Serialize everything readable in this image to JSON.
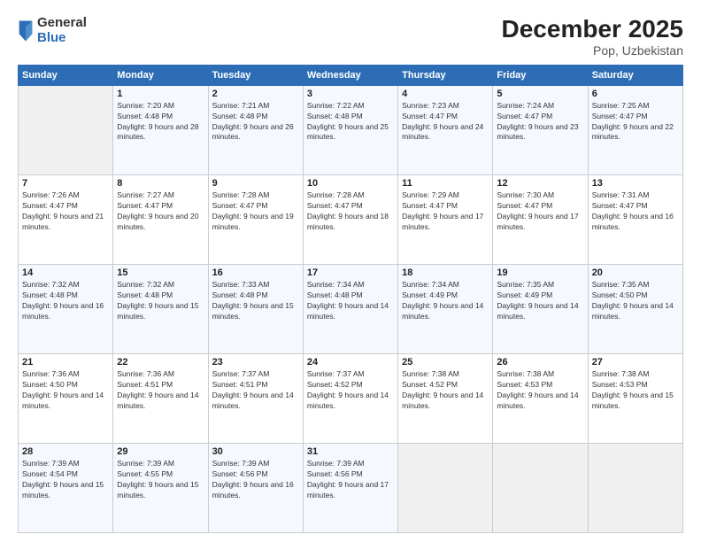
{
  "logo": {
    "general": "General",
    "blue": "Blue"
  },
  "title": "December 2025",
  "subtitle": "Pop, Uzbekistan",
  "days_header": [
    "Sunday",
    "Monday",
    "Tuesday",
    "Wednesday",
    "Thursday",
    "Friday",
    "Saturday"
  ],
  "weeks": [
    [
      {
        "day": "",
        "sunrise": "",
        "sunset": "",
        "daylight": ""
      },
      {
        "day": "1",
        "sunrise": "Sunrise: 7:20 AM",
        "sunset": "Sunset: 4:48 PM",
        "daylight": "Daylight: 9 hours and 28 minutes."
      },
      {
        "day": "2",
        "sunrise": "Sunrise: 7:21 AM",
        "sunset": "Sunset: 4:48 PM",
        "daylight": "Daylight: 9 hours and 26 minutes."
      },
      {
        "day": "3",
        "sunrise": "Sunrise: 7:22 AM",
        "sunset": "Sunset: 4:48 PM",
        "daylight": "Daylight: 9 hours and 25 minutes."
      },
      {
        "day": "4",
        "sunrise": "Sunrise: 7:23 AM",
        "sunset": "Sunset: 4:47 PM",
        "daylight": "Daylight: 9 hours and 24 minutes."
      },
      {
        "day": "5",
        "sunrise": "Sunrise: 7:24 AM",
        "sunset": "Sunset: 4:47 PM",
        "daylight": "Daylight: 9 hours and 23 minutes."
      },
      {
        "day": "6",
        "sunrise": "Sunrise: 7:25 AM",
        "sunset": "Sunset: 4:47 PM",
        "daylight": "Daylight: 9 hours and 22 minutes."
      }
    ],
    [
      {
        "day": "7",
        "sunrise": "Sunrise: 7:26 AM",
        "sunset": "Sunset: 4:47 PM",
        "daylight": "Daylight: 9 hours and 21 minutes."
      },
      {
        "day": "8",
        "sunrise": "Sunrise: 7:27 AM",
        "sunset": "Sunset: 4:47 PM",
        "daylight": "Daylight: 9 hours and 20 minutes."
      },
      {
        "day": "9",
        "sunrise": "Sunrise: 7:28 AM",
        "sunset": "Sunset: 4:47 PM",
        "daylight": "Daylight: 9 hours and 19 minutes."
      },
      {
        "day": "10",
        "sunrise": "Sunrise: 7:28 AM",
        "sunset": "Sunset: 4:47 PM",
        "daylight": "Daylight: 9 hours and 18 minutes."
      },
      {
        "day": "11",
        "sunrise": "Sunrise: 7:29 AM",
        "sunset": "Sunset: 4:47 PM",
        "daylight": "Daylight: 9 hours and 17 minutes."
      },
      {
        "day": "12",
        "sunrise": "Sunrise: 7:30 AM",
        "sunset": "Sunset: 4:47 PM",
        "daylight": "Daylight: 9 hours and 17 minutes."
      },
      {
        "day": "13",
        "sunrise": "Sunrise: 7:31 AM",
        "sunset": "Sunset: 4:47 PM",
        "daylight": "Daylight: 9 hours and 16 minutes."
      }
    ],
    [
      {
        "day": "14",
        "sunrise": "Sunrise: 7:32 AM",
        "sunset": "Sunset: 4:48 PM",
        "daylight": "Daylight: 9 hours and 16 minutes."
      },
      {
        "day": "15",
        "sunrise": "Sunrise: 7:32 AM",
        "sunset": "Sunset: 4:48 PM",
        "daylight": "Daylight: 9 hours and 15 minutes."
      },
      {
        "day": "16",
        "sunrise": "Sunrise: 7:33 AM",
        "sunset": "Sunset: 4:48 PM",
        "daylight": "Daylight: 9 hours and 15 minutes."
      },
      {
        "day": "17",
        "sunrise": "Sunrise: 7:34 AM",
        "sunset": "Sunset: 4:48 PM",
        "daylight": "Daylight: 9 hours and 14 minutes."
      },
      {
        "day": "18",
        "sunrise": "Sunrise: 7:34 AM",
        "sunset": "Sunset: 4:49 PM",
        "daylight": "Daylight: 9 hours and 14 minutes."
      },
      {
        "day": "19",
        "sunrise": "Sunrise: 7:35 AM",
        "sunset": "Sunset: 4:49 PM",
        "daylight": "Daylight: 9 hours and 14 minutes."
      },
      {
        "day": "20",
        "sunrise": "Sunrise: 7:35 AM",
        "sunset": "Sunset: 4:50 PM",
        "daylight": "Daylight: 9 hours and 14 minutes."
      }
    ],
    [
      {
        "day": "21",
        "sunrise": "Sunrise: 7:36 AM",
        "sunset": "Sunset: 4:50 PM",
        "daylight": "Daylight: 9 hours and 14 minutes."
      },
      {
        "day": "22",
        "sunrise": "Sunrise: 7:36 AM",
        "sunset": "Sunset: 4:51 PM",
        "daylight": "Daylight: 9 hours and 14 minutes."
      },
      {
        "day": "23",
        "sunrise": "Sunrise: 7:37 AM",
        "sunset": "Sunset: 4:51 PM",
        "daylight": "Daylight: 9 hours and 14 minutes."
      },
      {
        "day": "24",
        "sunrise": "Sunrise: 7:37 AM",
        "sunset": "Sunset: 4:52 PM",
        "daylight": "Daylight: 9 hours and 14 minutes."
      },
      {
        "day": "25",
        "sunrise": "Sunrise: 7:38 AM",
        "sunset": "Sunset: 4:52 PM",
        "daylight": "Daylight: 9 hours and 14 minutes."
      },
      {
        "day": "26",
        "sunrise": "Sunrise: 7:38 AM",
        "sunset": "Sunset: 4:53 PM",
        "daylight": "Daylight: 9 hours and 14 minutes."
      },
      {
        "day": "27",
        "sunrise": "Sunrise: 7:38 AM",
        "sunset": "Sunset: 4:53 PM",
        "daylight": "Daylight: 9 hours and 15 minutes."
      }
    ],
    [
      {
        "day": "28",
        "sunrise": "Sunrise: 7:39 AM",
        "sunset": "Sunset: 4:54 PM",
        "daylight": "Daylight: 9 hours and 15 minutes."
      },
      {
        "day": "29",
        "sunrise": "Sunrise: 7:39 AM",
        "sunset": "Sunset: 4:55 PM",
        "daylight": "Daylight: 9 hours and 15 minutes."
      },
      {
        "day": "30",
        "sunrise": "Sunrise: 7:39 AM",
        "sunset": "Sunset: 4:56 PM",
        "daylight": "Daylight: 9 hours and 16 minutes."
      },
      {
        "day": "31",
        "sunrise": "Sunrise: 7:39 AM",
        "sunset": "Sunset: 4:56 PM",
        "daylight": "Daylight: 9 hours and 17 minutes."
      },
      {
        "day": "",
        "sunrise": "",
        "sunset": "",
        "daylight": ""
      },
      {
        "day": "",
        "sunrise": "",
        "sunset": "",
        "daylight": ""
      },
      {
        "day": "",
        "sunrise": "",
        "sunset": "",
        "daylight": ""
      }
    ]
  ]
}
